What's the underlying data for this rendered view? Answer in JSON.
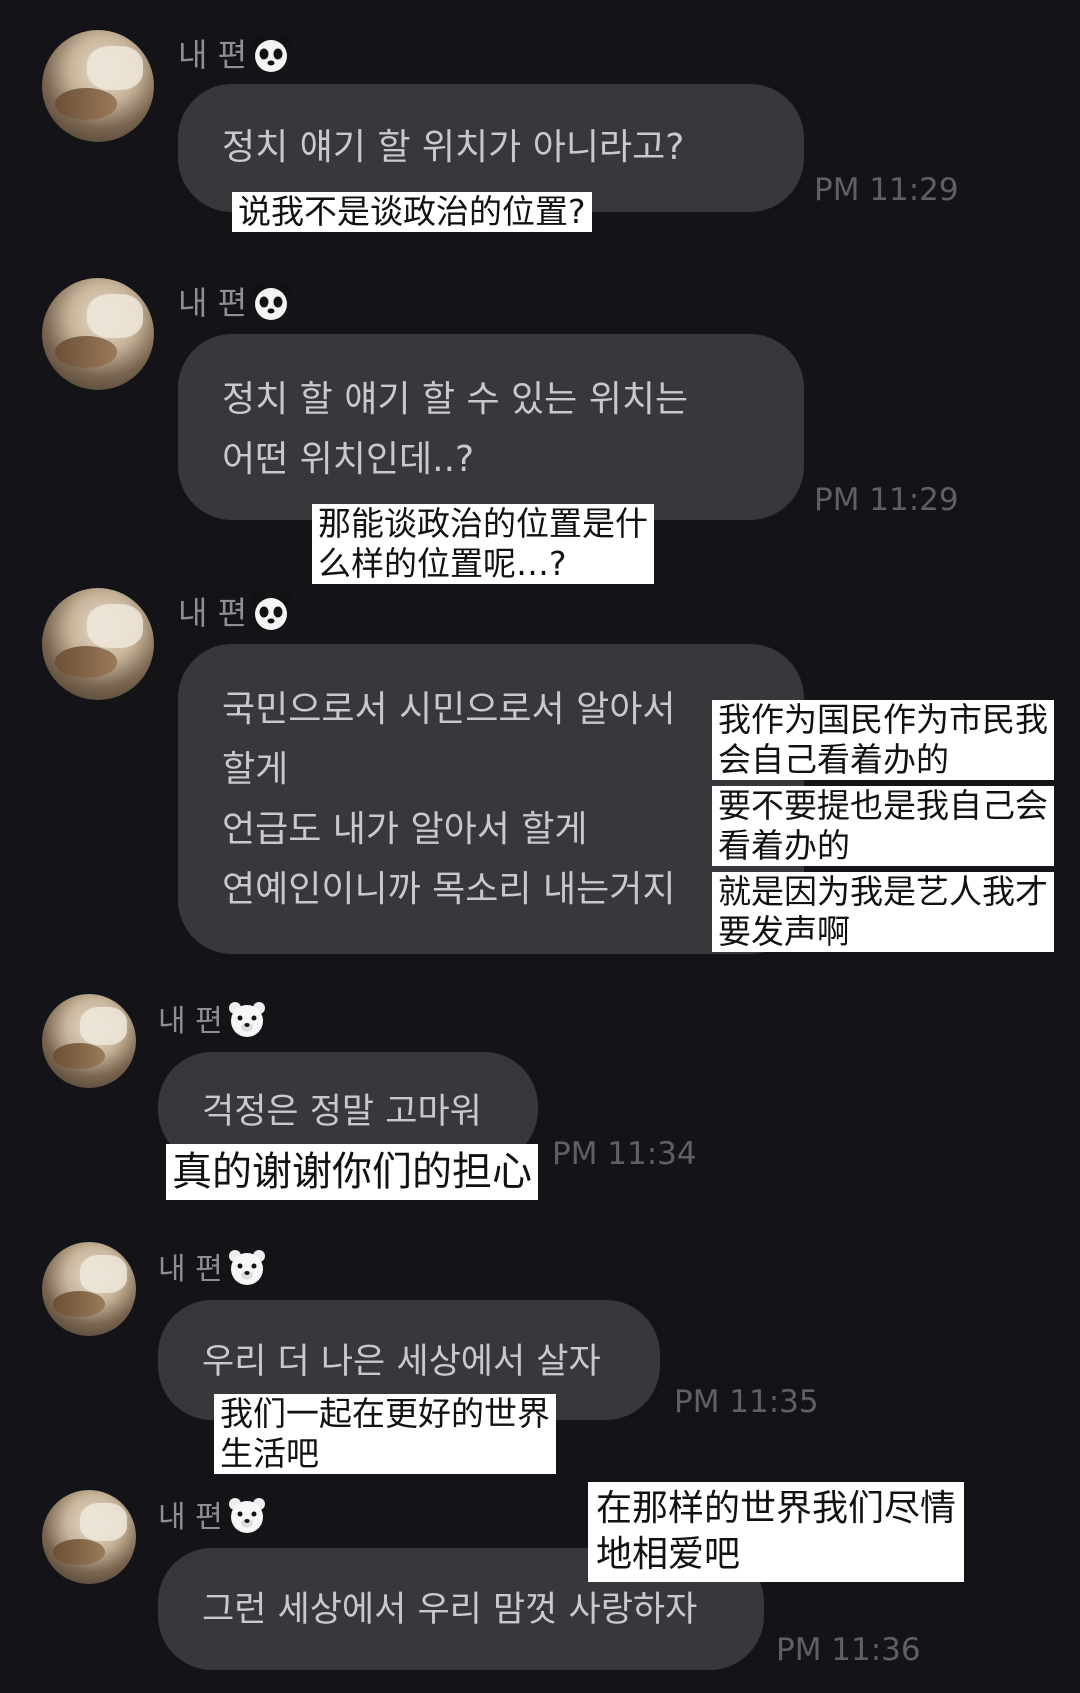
{
  "sender_name": "내 편",
  "messages": [
    {
      "korean": "정치 얘기 할 위치가 아니라고?",
      "time": "PM 11:29",
      "translation": [
        "说我不是谈政治的位置?"
      ]
    },
    {
      "korean": "정치 할 얘기 할 수 있는 위치는\n어떤 위치인데..?",
      "time": "PM 11:29",
      "translation": [
        "那能谈政治的位置是什\n么样的位置呢…?"
      ]
    },
    {
      "korean": "국민으로서 시민으로서 알아서\n할게\n언급도 내가 알아서 할게\n연예인이니까 목소리 내는거지",
      "time": "",
      "translation": [
        "我作为国民作为市民我\n会自己看着办的",
        "要不要提也是我自己会\n看着办的",
        "就是因为我是艺人我才\n要发声啊"
      ]
    },
    {
      "korean": "걱정은 정말 고마워",
      "time": "PM 11:34",
      "translation": [
        "真的谢谢你们的担心"
      ]
    },
    {
      "korean": "우리 더 나은 세상에서 살자",
      "time": "PM 11:35",
      "translation": [
        "我们一起在更好的世界\n生活吧"
      ]
    },
    {
      "korean": "그런 세상에서 우리 맘껏 사랑하자",
      "time": "PM 11:36",
      "translation": [
        "在那样的世界我们尽情\n地相爱吧"
      ]
    }
  ],
  "icons": {
    "sender_badge": "panda-face-icon",
    "sender_badge_alt": "polar-bear-face-icon"
  },
  "colors": {
    "background": "#141418",
    "bubble": "#37373c",
    "message_text": "#c9c9cc",
    "timestamp": "#5f5f64",
    "translation_box": "#ffffff"
  }
}
